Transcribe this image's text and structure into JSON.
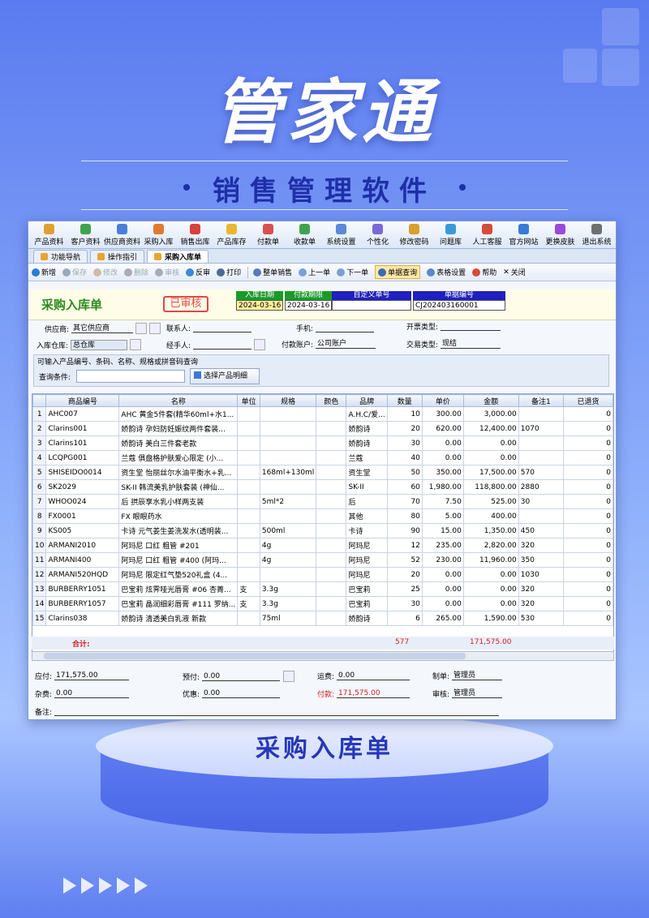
{
  "poster": {
    "brand": "管家通",
    "subtitle": "销售管理软件",
    "pedestal_label": "采购入库单"
  },
  "toolbar": [
    {
      "label": "产品资料",
      "icon": "product-icon",
      "color": "#e0a030"
    },
    {
      "label": "客户资料",
      "icon": "customer-icon",
      "color": "#3fa34d"
    },
    {
      "label": "供应商资料",
      "icon": "supplier-icon",
      "color": "#4a7fd8"
    },
    {
      "label": "采购入库",
      "icon": "purchase-icon",
      "color": "#e07a30"
    },
    {
      "label": "销售出库",
      "icon": "sales-icon",
      "color": "#d8403a"
    },
    {
      "label": "产品库存",
      "icon": "stock-icon",
      "color": "#e8b830"
    },
    {
      "label": "付款单",
      "icon": "payment-icon",
      "color": "#d85050"
    },
    {
      "label": "收款单",
      "icon": "receipt-icon",
      "color": "#3fa34d"
    },
    {
      "label": "系统设置",
      "icon": "settings-icon",
      "color": "#5a8ad8"
    },
    {
      "label": "个性化",
      "icon": "personalize-icon",
      "color": "#7a6ad8"
    },
    {
      "label": "修改密码",
      "icon": "password-icon",
      "color": "#d8a030"
    },
    {
      "label": "问题库",
      "icon": "faq-icon",
      "color": "#3a9ad8"
    },
    {
      "label": "人工客服",
      "icon": "support-icon",
      "color": "#d84a3a"
    },
    {
      "label": "官方网站",
      "icon": "website-icon",
      "color": "#3a7ad8"
    },
    {
      "label": "更换皮肤",
      "icon": "skin-icon",
      "color": "#9a4ad8"
    },
    {
      "label": "退出系统",
      "icon": "exit-icon",
      "color": "#707070"
    }
  ],
  "tabs": [
    {
      "label": "功能导航"
    },
    {
      "label": "操作指引"
    },
    {
      "label": "采购入库单"
    }
  ],
  "actions": {
    "new": "新增",
    "save": "保存",
    "edit": "修改",
    "delete": "删除",
    "audit": "审核",
    "unaudit": "反审",
    "print": "打印",
    "whole_sale": "整单销售",
    "prev": "上一单",
    "next": "下一单",
    "doc_query": "单据查询",
    "table_settings": "表格设置",
    "help": "帮助",
    "close": "关闭"
  },
  "header": {
    "title": "采购入库单",
    "stamp": "已审核",
    "fields": [
      {
        "label": "入库日期",
        "value": "2024-03-16"
      },
      {
        "label": "付款期限",
        "value": "2024-03-16"
      },
      {
        "label": "自定义单号",
        "value": ""
      },
      {
        "label": "单据编号",
        "value": "CJ202403160001"
      }
    ]
  },
  "form": {
    "supplier_label": "供应商:",
    "supplier": "其它供应商",
    "contact_label": "联系人:",
    "contact": "",
    "phone_label": "手机:",
    "phone": "",
    "invoice_label": "开票类型:",
    "invoice": "",
    "warehouse_label": "入库仓库:",
    "warehouse": "总仓库",
    "handler_label": "经手人:",
    "handler": "",
    "account_label": "付款账户:",
    "account": "公司账户",
    "trade_label": "交易类型:",
    "trade": "现结"
  },
  "query": {
    "hint": "可输入产品编号、条码、名称、规格或拼音码查询",
    "cond_label": "查询条件:",
    "cond_value": "",
    "select_button": "选择产品明细"
  },
  "table": {
    "columns": [
      "",
      "商品编号",
      "名称",
      "单位",
      "规格",
      "颜色",
      "品牌",
      "数量",
      "单价",
      "金额",
      "备注1",
      "已退货"
    ],
    "rows": [
      [
        "1",
        "AHC007",
        "AHC 黄金5件套(精华60ml+水1...",
        "",
        "",
        "",
        "A.H.C/爱...",
        "10",
        "300.00",
        "3,000.00",
        "",
        "0"
      ],
      [
        "2",
        "Clarins001",
        "娇韵诗 孕妇防妊娠纹两件套装...",
        "",
        "",
        "",
        "娇韵诗",
        "20",
        "620.00",
        "12,400.00",
        "1070",
        "0"
      ],
      [
        "3",
        "Clarins101",
        "娇韵诗 美白三件套老款",
        "",
        "",
        "",
        "娇韵诗",
        "30",
        "0.00",
        "0.00",
        "",
        "0"
      ],
      [
        "4",
        "LCQPG001",
        "兰蔻 俱盘格护肤爱心限定 (小...",
        "",
        "",
        "",
        "兰蔻",
        "40",
        "0.00",
        "0.00",
        "",
        "0"
      ],
      [
        "5",
        "SHISEIDO0014",
        "资生堂 怡丽丝尔水油平衡水+乳...",
        "",
        "168ml+130ml",
        "",
        "资生堂",
        "50",
        "350.00",
        "17,500.00",
        "570",
        "0"
      ],
      [
        "6",
        "SK2029",
        "SK-II 韩流美乳护肤套装 (神仙...",
        "",
        "",
        "",
        "SK-II",
        "60",
        "1,980.00",
        "118,800.00",
        "2880",
        "0"
      ],
      [
        "7",
        "WHOO024",
        "后 拱辰享水乳小样两支装",
        "",
        "5ml*2",
        "",
        "后",
        "70",
        "7.50",
        "525.00",
        "30",
        "0"
      ],
      [
        "8",
        "FX0001",
        "FX 眼眼药水",
        "",
        "",
        "",
        "其他",
        "80",
        "5.00",
        "400.00",
        "",
        "0"
      ],
      [
        "9",
        "KS005",
        "卡诗 元气姜生姜洗发水(透明装...",
        "",
        "500ml",
        "",
        "卡诗",
        "90",
        "15.00",
        "1,350.00",
        "450",
        "0"
      ],
      [
        "10",
        "ARMANI2010",
        "阿玛尼 口红 粗管 #201",
        "",
        "4g",
        "",
        "阿玛尼",
        "12",
        "235.00",
        "2,820.00",
        "320",
        "0"
      ],
      [
        "11",
        "ARMANI400",
        "阿玛尼 口红 粗管 #400 (阿玛...",
        "",
        "4g",
        "",
        "阿玛尼",
        "52",
        "230.00",
        "11,960.00",
        "350",
        "0"
      ],
      [
        "12",
        "ARMANI520HQD",
        "阿玛尼 限定红气垫520礼盒 (4...",
        "",
        "",
        "",
        "阿玛尼",
        "20",
        "0.00",
        "0.00",
        "1030",
        "0"
      ],
      [
        "13",
        "BURBERRY1051",
        "巴宝莉 炫霁哑光唇膏 #06 杏菁...",
        "支",
        "3.3g",
        "",
        "巴宝莉",
        "25",
        "0.00",
        "0.00",
        "320",
        "0"
      ],
      [
        "14",
        "BURBERRY1057",
        "巴宝莉 晶润细彩唇膏 #111 罗纳...",
        "支",
        "3.3g",
        "",
        "巴宝莉",
        "30",
        "0.00",
        "0.00",
        "320",
        "0"
      ],
      [
        "15",
        "Clarins038",
        "娇韵诗 清透美白乳液 新款",
        "",
        "75ml",
        "",
        "娇韵诗",
        "6",
        "265.00",
        "1,590.00",
        "530",
        "0"
      ]
    ],
    "total_label": "合计:",
    "total_qty": "577",
    "total_amount": "171,575.00"
  },
  "footer": {
    "payable_label": "应付:",
    "payable": "171,575.00",
    "prepaid_label": "预付:",
    "prepaid": "0.00",
    "freight_label": "运费:",
    "freight": "0.00",
    "maker_label": "制单:",
    "maker": "管理员",
    "misc_label": "杂费:",
    "misc": "0.00",
    "discount_label": "优惠:",
    "discount": "0.00",
    "paid_label": "付款:",
    "paid": "171,575.00",
    "auditor_label": "审核:",
    "auditor": "管理员",
    "remark_label": "备注:",
    "remark": ""
  },
  "colors": {
    "accent": "#2b8a1f",
    "stamp": "#e04848",
    "header_bar": "#2020c0",
    "header_green": "#1a9a2a"
  }
}
